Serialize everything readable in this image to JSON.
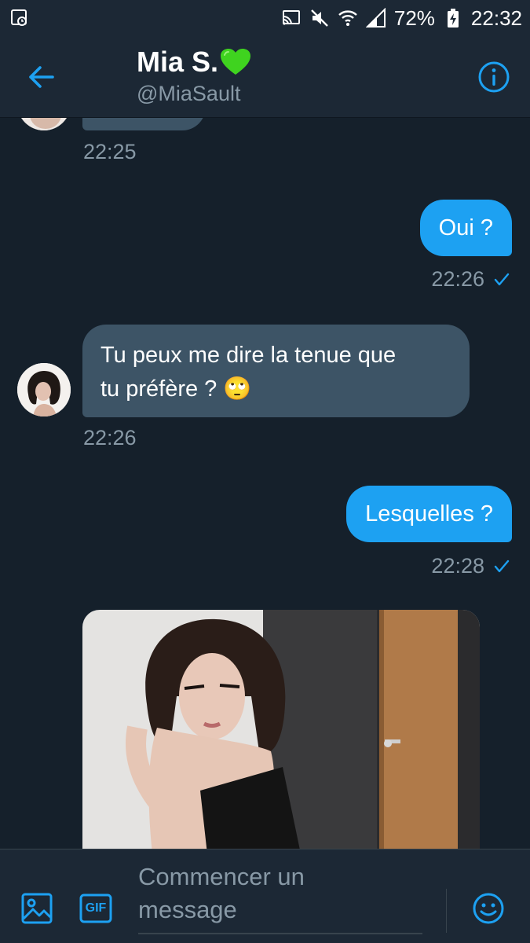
{
  "status_bar": {
    "battery": "72%",
    "time": "22:32"
  },
  "header": {
    "name": "Mia S.",
    "name_emoji": "green-heart",
    "handle": "@MiaSault"
  },
  "messages": [
    {
      "direction": "in",
      "text": "",
      "time": "22:25"
    },
    {
      "direction": "out",
      "text": "Oui ?",
      "time": "22:26",
      "status": "read-check"
    },
    {
      "direction": "in",
      "text_line1": "Tu peux me dire la tenue que",
      "text_line2": "tu préfère ? 🙄",
      "time": "22:26"
    },
    {
      "direction": "out",
      "text": "Lesquelles ?",
      "time": "22:28",
      "status": "read-check"
    },
    {
      "direction": "in",
      "type": "image"
    }
  ],
  "composer": {
    "placeholder_line1": "Commencer un",
    "placeholder_line2": "message",
    "gif_label": "GIF"
  },
  "colors": {
    "background": "#15202b",
    "bar": "#1c2835",
    "incoming_bubble": "#3d5466",
    "outgoing_bubble": "#1da1f2",
    "accent": "#1da1f2",
    "secondary_text": "#8899a6"
  }
}
